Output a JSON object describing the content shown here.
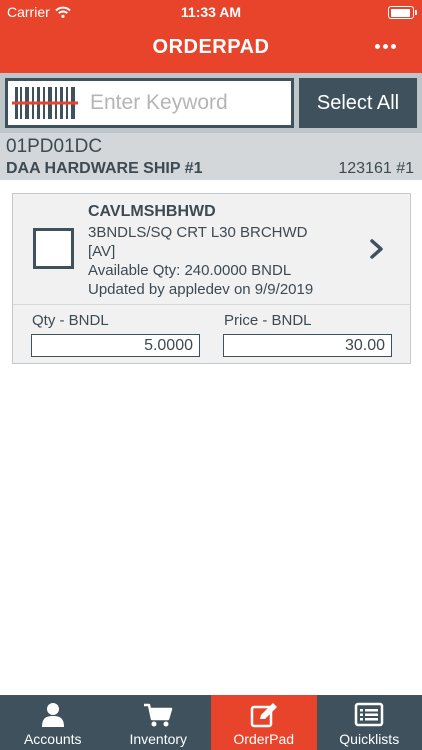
{
  "status_bar": {
    "carrier": "Carrier",
    "time": "11:33 AM"
  },
  "header": {
    "title": "ORDERPAD",
    "menu_icon": "more-horizontal-icon"
  },
  "search": {
    "placeholder": "Enter Keyword",
    "value": "",
    "select_all_label": "Select All",
    "scan_icon": "barcode-scanner-icon"
  },
  "account": {
    "code": "01PD01DC",
    "name": "DAA HARDWARE SHIP #1",
    "number": "123161 #1"
  },
  "items": [
    {
      "code": "CAVLMSHBHWD",
      "description_line1": "3BNDLS/SQ CRT L30  BRCHWD",
      "description_line2": "[AV]",
      "available": "Available Qty: 240.0000 BNDL",
      "updated": "Updated by appledev on 9/9/2019",
      "checked": false,
      "qty_label": "Qty - BNDL",
      "qty_value": "5.0000",
      "price_label": "Price - BNDL",
      "price_value": "30.00"
    }
  ],
  "tabbar": {
    "active": "orderpad",
    "tabs": [
      {
        "id": "accounts",
        "label": "Accounts",
        "icon": "person-icon"
      },
      {
        "id": "inventory",
        "label": "Inventory",
        "icon": "shopping-cart-icon"
      },
      {
        "id": "orderpad",
        "label": "OrderPad",
        "icon": "edit-icon"
      },
      {
        "id": "quicklists",
        "label": "Quicklists",
        "icon": "list-icon"
      }
    ]
  },
  "colors": {
    "brand_red": "#e8442c",
    "slate": "#3e515c",
    "search_bg": "#bfc6ca",
    "account_bg": "#d3d7d9"
  }
}
